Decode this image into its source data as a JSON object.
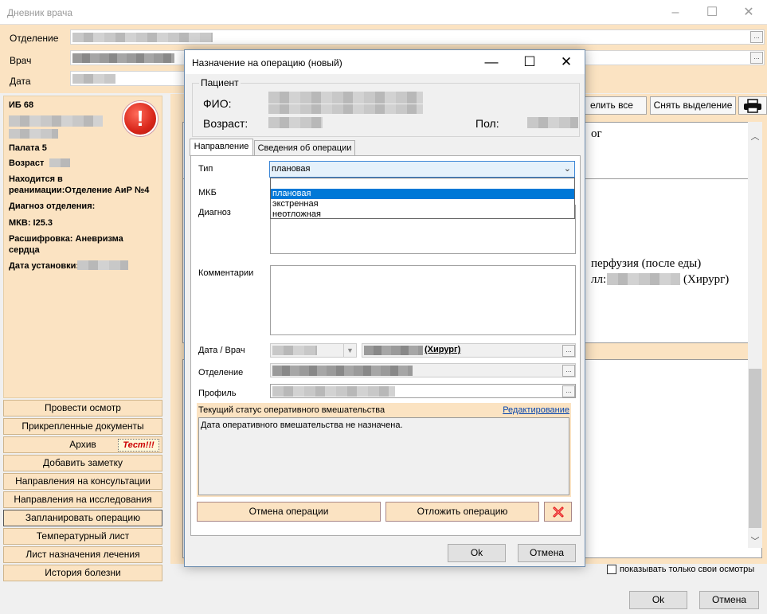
{
  "window": {
    "title": "Дневник врача",
    "minimize": "–",
    "maximize": "☐",
    "close": "✕"
  },
  "form": {
    "department_label": "Отделение",
    "doctor_label": "Врач",
    "date_label": "Дата"
  },
  "patient_card": {
    "ib": "ИБ 68",
    "alert_icon": "!",
    "ward": "Палата 5",
    "age_label": "Возраст",
    "location": "Находится в реанимации:Отделение АиР №4",
    "dept_diagnosis_label": "Диагноз отделения:",
    "mkb": "МКВ: I25.3",
    "decoding": "Расшифровка: Аневризма сердца",
    "install_date_label": "Дата установки:"
  },
  "left_buttons": [
    {
      "label": "Провести осмотр"
    },
    {
      "label": "Прикрепленные документы"
    },
    {
      "label": "Архив"
    },
    {
      "label": "Добавить заметку"
    },
    {
      "label": "Направления на консультации"
    },
    {
      "label": "Направления на исследования"
    },
    {
      "label": "Запланировать операцию"
    },
    {
      "label": "Температурный лист"
    },
    {
      "label": "Лист назначения лечения"
    },
    {
      "label": "История болезни"
    }
  ],
  "test_badge": "Тест!!!",
  "right_toolbar": {
    "select_all_partial": "елить все",
    "deselect": "Снять выделение",
    "print_icon": "print-icon"
  },
  "right_text": {
    "og": "ог",
    "perfusion": "перфузия (после еды)",
    "ll": "лл:",
    "surgeon": "(Хирург)"
  },
  "bottom": {
    "only_my_exams": "показывать только свои осмотры",
    "ok": "Ok",
    "cancel": "Отмена"
  },
  "dialog": {
    "title": "Назначение на операцию (новый)",
    "patient_group": "Пациент",
    "fio_label": "ФИО:",
    "age_label": "Возраст:",
    "sex_label": "Пол:",
    "tabs": [
      {
        "label": "Направление"
      },
      {
        "label": "Сведения об операции"
      }
    ],
    "type_label": "Тип",
    "type_value": "плановая",
    "type_options": [
      {
        "label": "плановая",
        "selected": true
      },
      {
        "label": "экстренная"
      },
      {
        "label": "неотложная"
      }
    ],
    "mkb_label": "МКБ",
    "diagnosis_label": "Диагноз",
    "comments_label": "Комментарии",
    "date_doctor_label": "Дата / Врач",
    "surgeon_tag": "(Хирург)",
    "department_label": "Отделение",
    "profile_label": "Профиль",
    "status_header": "Текущий статус оперативного вмешательства",
    "edit_link": "Редактирование",
    "status_text": "Дата оперативного вмешательства не назначена.",
    "cancel_operation": "Отмена операции",
    "postpone_operation": "Отложить операцию",
    "ok": "Ok",
    "cancel": "Отмена"
  }
}
